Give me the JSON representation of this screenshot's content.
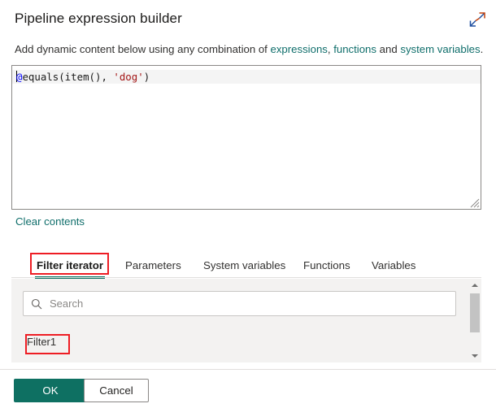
{
  "header": {
    "title": "Pipeline expression builder",
    "expand_icon": "expand-diagonal-arrows-icon"
  },
  "subtitle": {
    "prefix": "Add dynamic content below using any combination of ",
    "link_expressions": "expressions",
    "sep1": ", ",
    "link_functions": "functions",
    "sep2": " and ",
    "link_system_variables": "system variables",
    "suffix": "."
  },
  "editor": {
    "tokens": {
      "at": "@",
      "plain_before": "equals(item(), ",
      "string": "'dog'",
      "plain_after": ")"
    },
    "full_expression": "@equals(item(), 'dog')",
    "resize_handle": "resize-grip-icon"
  },
  "clear_contents_label": "Clear contents",
  "tabs": {
    "items": [
      {
        "label": "Filter iterator",
        "active": true
      },
      {
        "label": "Parameters",
        "active": false
      },
      {
        "label": "System variables",
        "active": false
      },
      {
        "label": "Functions",
        "active": false
      },
      {
        "label": "Variables",
        "active": false
      }
    ]
  },
  "pane": {
    "search": {
      "icon": "search-icon",
      "value": "",
      "placeholder": "Search"
    },
    "results": [
      {
        "label": "Filter1"
      }
    ],
    "scrollbar": {
      "up_icon": "scroll-up-arrow-icon",
      "down_icon": "scroll-down-arrow-icon"
    }
  },
  "footer": {
    "ok_label": "OK",
    "cancel_label": "Cancel"
  },
  "colors": {
    "accent_teal": "#0e7062",
    "link_teal": "#0f6e6b",
    "annotation_red": "#ee1d24",
    "code_at_blue": "#0000ff",
    "code_string_red": "#a31515"
  }
}
